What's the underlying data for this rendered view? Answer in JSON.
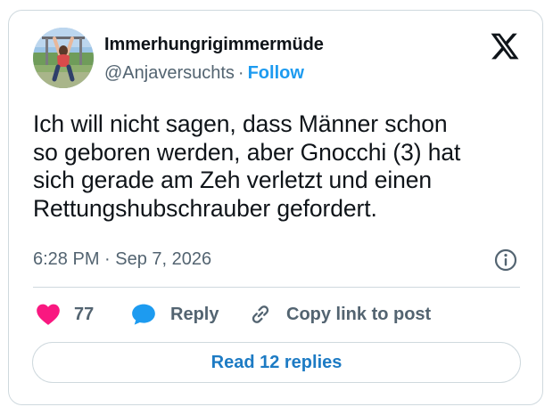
{
  "author": {
    "display_name": "Immerhungrigimmermüde",
    "handle": "@Anjaversuchts",
    "separator": "·",
    "follow_label": "Follow",
    "avatar_icon": "profile-photo"
  },
  "brand": {
    "logo_icon": "x-logo-icon"
  },
  "tweet": {
    "text": "Ich will nicht sagen, dass Männer schon\nso geboren werden, aber Gnocchi (3) hat\nsich gerade am Zeh verletzt und einen\nRettungshubschrauber gefordert.",
    "timestamp": "6:28 PM · Sep 7, 2026"
  },
  "actions": {
    "like_count": "77",
    "reply_label": "Reply",
    "copy_label": "Copy link to post",
    "read_replies_label": "Read 12 replies"
  },
  "colors": {
    "accent": "#1d9bf0",
    "like": "#f91880",
    "reply_icon": "#1d9bf0",
    "secondary_text": "#536471",
    "border": "#cfd9de"
  }
}
